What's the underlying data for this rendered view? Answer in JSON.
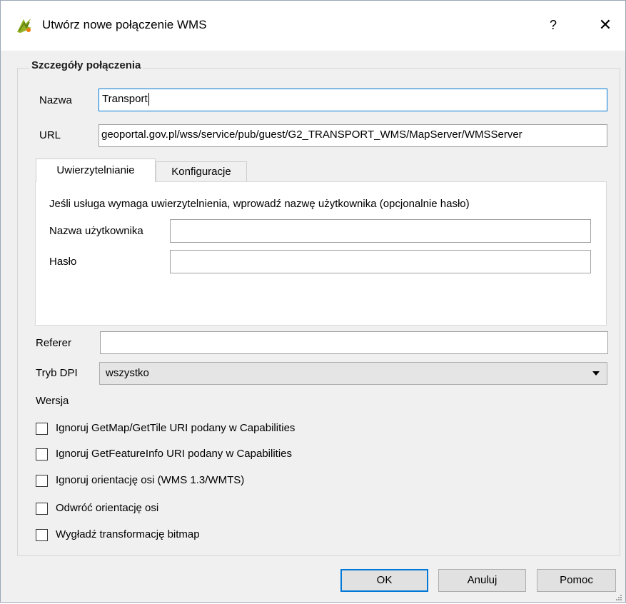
{
  "titlebar": {
    "title": "Utwórz nowe połączenie WMS",
    "help_label": "?",
    "close_label": "✕"
  },
  "group": {
    "title": "Szczegóły połączenia"
  },
  "fields": {
    "name_label": "Nazwa",
    "name_value": "Transport",
    "url_label": "URL",
    "url_value": "geoportal.gov.pl/wss/service/pub/guest/G2_TRANSPORT_WMS/MapServer/WMSServer"
  },
  "tabs": [
    {
      "label": "Uwierzytelnianie",
      "active": true
    },
    {
      "label": "Konfiguracje",
      "active": false
    }
  ],
  "auth": {
    "info": "Jeśli usługa wymaga uwierzytelnienia, wprowadź nazwę użytkownika (opcjonalnie hasło)",
    "username_label": "Nazwa użytkownika",
    "username_value": "",
    "password_label": "Hasło",
    "password_value": ""
  },
  "referer": {
    "label": "Referer",
    "value": ""
  },
  "dpi": {
    "label": "Tryb DPI",
    "selected": "wszystko"
  },
  "version_label": "Wersja",
  "checkboxes": [
    {
      "label": "Ignoruj GetMap/GetTile URI podany w Capabilities",
      "checked": false
    },
    {
      "label": "Ignoruj GetFeatureInfo URI podany w Capabilities",
      "checked": false
    },
    {
      "label": "Ignoruj orientację osi (WMS 1.3/WMTS)",
      "checked": false
    },
    {
      "label": "Odwróć orientację osi",
      "checked": false
    },
    {
      "label": "Wygładź transformację bitmap",
      "checked": false
    }
  ],
  "buttons": {
    "ok": "OK",
    "cancel": "Anuluj",
    "help": "Pomoc"
  },
  "colors": {
    "focus_border": "#0078d7",
    "dialog_bg": "#f0f0f0"
  }
}
